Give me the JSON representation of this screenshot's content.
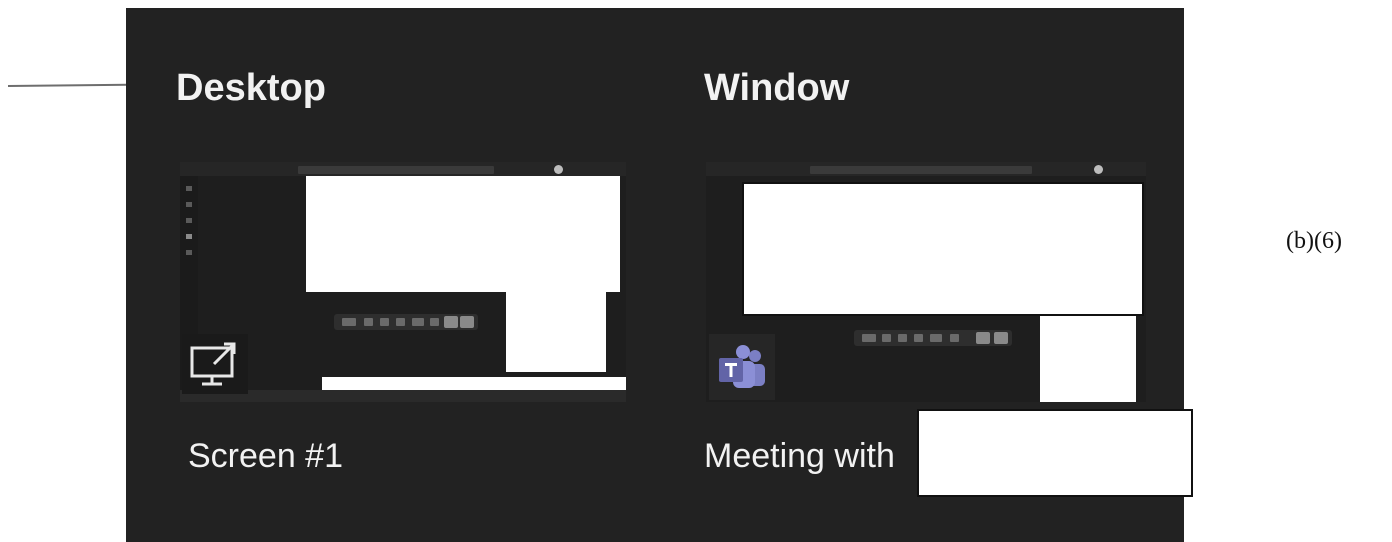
{
  "sections": {
    "desktop": {
      "title": "Desktop",
      "caption": "Screen #1"
    },
    "window": {
      "title": "Window",
      "caption": "Meeting with"
    }
  },
  "annotation": "(b)(6)",
  "icons": {
    "desktop_share": "share-screen-icon",
    "window_app": "teams-icon",
    "pointer": "arrow-icon"
  },
  "colors": {
    "panel_background": "#222222",
    "text": "#f2f2f2",
    "teams_brand": "#6264a7"
  }
}
